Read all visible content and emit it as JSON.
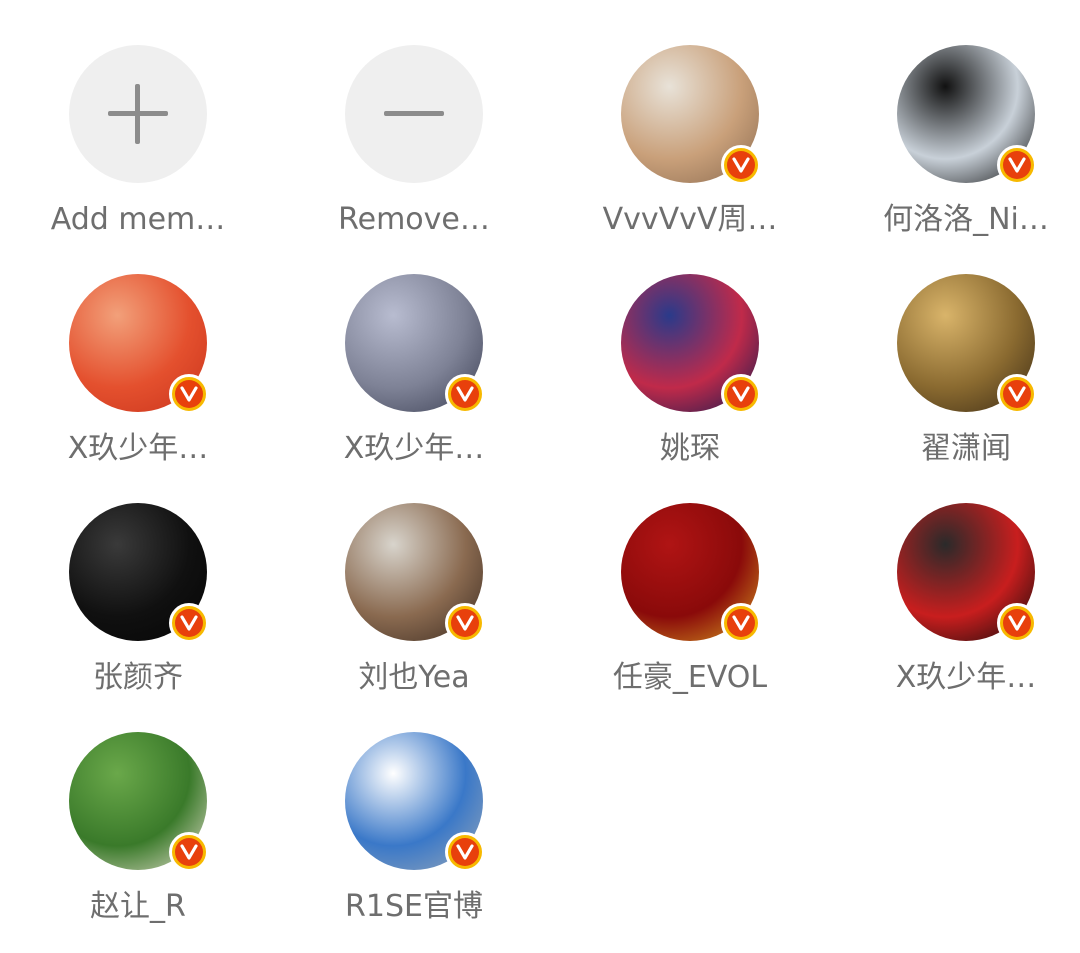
{
  "members": [
    {
      "type": "action",
      "label": "Add mem…",
      "icon": "plus-icon"
    },
    {
      "type": "action",
      "label": "Remove…",
      "icon": "minus-icon"
    },
    {
      "type": "user",
      "label": "VvvVvV周…",
      "verified": true,
      "avatar_colors": [
        "#e8e2d8",
        "#c9a07a",
        "#8a6a4f"
      ]
    },
    {
      "type": "user",
      "label": "何洛洛_Ni…",
      "verified": true,
      "avatar_colors": [
        "#111111",
        "#c8d0d8",
        "#0a0a0a"
      ]
    },
    {
      "type": "user",
      "label": "X玖少年…",
      "verified": true,
      "avatar_colors": [
        "#f2a07a",
        "#e4502e",
        "#c9341c"
      ]
    },
    {
      "type": "user",
      "label": "X玖少年…",
      "verified": true,
      "avatar_colors": [
        "#b8bcd0",
        "#7e8296",
        "#3a3e52"
      ]
    },
    {
      "type": "user",
      "label": "姚琛",
      "verified": true,
      "avatar_colors": [
        "#2a3a8a",
        "#c02a4a",
        "#101a50"
      ]
    },
    {
      "type": "user",
      "label": "翟潇闻",
      "verified": true,
      "avatar_colors": [
        "#d9b46a",
        "#8a6a30",
        "#3a2a14"
      ]
    },
    {
      "type": "user",
      "label": "张颜齐",
      "verified": true,
      "avatar_colors": [
        "#3a3a3a",
        "#101010",
        "#050505"
      ]
    },
    {
      "type": "user",
      "label": "刘也Yea",
      "verified": true,
      "avatar_colors": [
        "#d8d4cc",
        "#8a6a50",
        "#3a2a20"
      ]
    },
    {
      "type": "user",
      "label": "任豪_EVOL",
      "verified": true,
      "avatar_colors": [
        "#b01414",
        "#8a0a0a",
        "#d8a020"
      ]
    },
    {
      "type": "user",
      "label": "X玖少年…",
      "verified": true,
      "avatar_colors": [
        "#2a2a2a",
        "#c81e1e",
        "#0a0a0a"
      ]
    },
    {
      "type": "user",
      "label": "赵让_R",
      "verified": true,
      "avatar_colors": [
        "#6aa84a",
        "#3a7a2a",
        "#e8e0d0"
      ]
    },
    {
      "type": "user",
      "label": "R1SE官博",
      "verified": true,
      "avatar_colors": [
        "#ffffff",
        "#3a78c8",
        "#9aa8b8"
      ]
    }
  ],
  "badge_icon": "verified-v-icon"
}
